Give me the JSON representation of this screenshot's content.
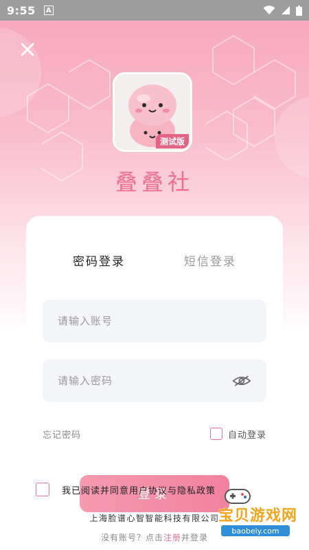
{
  "status_bar": {
    "time": "9:55",
    "indicator": "A"
  },
  "app": {
    "name": "叠叠社",
    "badge": "测试版",
    "close_icon": "close-icon"
  },
  "tabs": [
    {
      "label": "密码登录",
      "active": true
    },
    {
      "label": "短信登录",
      "active": false
    }
  ],
  "form": {
    "account_placeholder": "请输入账号",
    "account_value": "",
    "password_placeholder": "请输入密码",
    "password_value": "",
    "forgot_password": "忘记密码",
    "auto_login": "自动登录",
    "login_button": "登录"
  },
  "agreement": {
    "text": "我已阅读并同意用户协议与隐私政策"
  },
  "footer": {
    "company": "上海脸谱心智智能科技有限公司",
    "register_prefix": "没有账号？点击",
    "register_link": "注册",
    "register_suffix": "并登录"
  },
  "watermark": {
    "text": "宝贝游戏网",
    "url": "baobeiy.com"
  },
  "colors": {
    "accent": "#ef6e8f",
    "header_top": "#f7a9bd",
    "field_bg": "#f4f5f9"
  }
}
